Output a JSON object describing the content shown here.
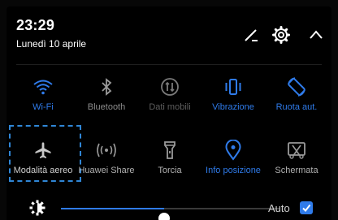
{
  "header": {
    "time": "23:29",
    "date": "Lunedì 10 aprile",
    "edit_icon": "pencil-edit-icon",
    "settings_icon": "gear-icon",
    "collapse_icon": "chevron-up-icon"
  },
  "tiles_row1": [
    {
      "label": "Wi-Fi",
      "icon": "wifi-icon",
      "active": true
    },
    {
      "label": "Bluetooth",
      "icon": "bluetooth-icon",
      "active": false
    },
    {
      "label": "Dati mobili",
      "icon": "mobile-data-icon",
      "active": false
    },
    {
      "label": "Vibrazione",
      "icon": "vibration-icon",
      "active": true
    },
    {
      "label": "Ruota aut.",
      "icon": "auto-rotate-icon",
      "active": true
    }
  ],
  "tiles_row2": [
    {
      "label": "Modalità aereo",
      "icon": "airplane-icon",
      "active": false
    },
    {
      "label": "Huawei Share",
      "icon": "huawei-share-icon",
      "active": false
    },
    {
      "label": "Torcia",
      "icon": "flashlight-icon",
      "active": false
    },
    {
      "label": "Info posizione",
      "icon": "location-icon",
      "active": true
    },
    {
      "label": "Schermata",
      "icon": "screenshot-icon",
      "active": false
    }
  ],
  "brightness": {
    "icon": "brightness-icon",
    "level": 0.47,
    "auto_label": "Auto",
    "auto_checked": true
  },
  "colors": {
    "accent": "#2f7bea",
    "inactive": "#8c8c8c",
    "highlight_border": "#2f86d6",
    "background": "#000000"
  }
}
